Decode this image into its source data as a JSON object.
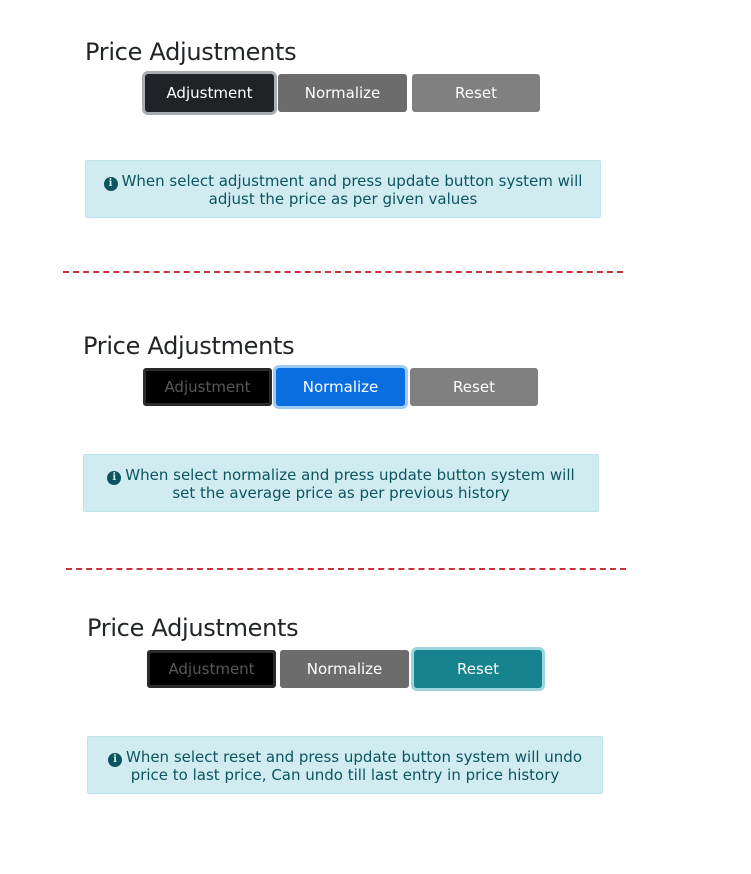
{
  "panels": [
    {
      "title": "Price Adjustments",
      "buttons": {
        "adjustment": "Adjustment",
        "normalize": "Normalize",
        "reset": "Reset"
      },
      "active": "adjustment",
      "info_icon": "info-circle-icon",
      "info_text": "When select adjustment and press update button system will adjust the price as per given values"
    },
    {
      "title": "Price Adjustments",
      "buttons": {
        "adjustment": "Adjustment",
        "normalize": "Normalize",
        "reset": "Reset"
      },
      "active": "normalize",
      "info_icon": "info-circle-icon",
      "info_text": "When select normalize and press update button system will set the average price as per previous history"
    },
    {
      "title": "Price Adjustments",
      "buttons": {
        "adjustment": "Adjustment",
        "normalize": "Normalize",
        "reset": "Reset"
      },
      "active": "reset",
      "info_icon": "info-circle-icon",
      "info_text": "When select reset and press update button system will undo price to last price, Can undo till last entry in price history"
    }
  ],
  "colors": {
    "divider": "#c9323a",
    "alert_bg": "#d1ecf1",
    "alert_text": "#0c5460",
    "normalize_active": "#0b6ee0",
    "reset_active": "#16838f"
  }
}
